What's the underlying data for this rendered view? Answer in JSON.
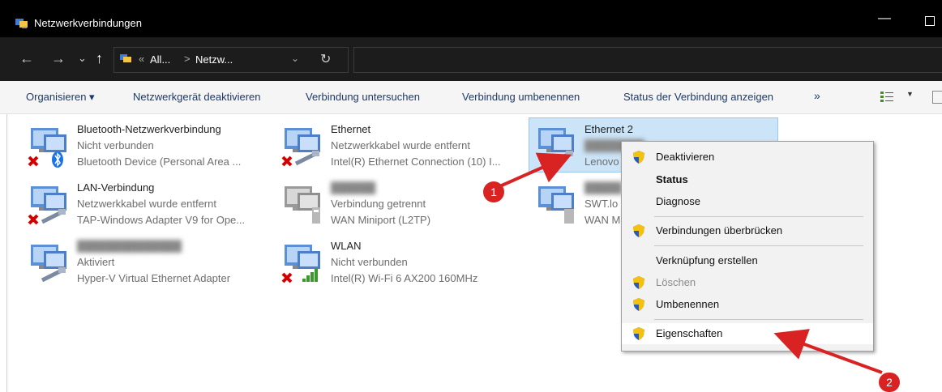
{
  "window": {
    "title": "Netzwerkverbindungen",
    "minimize_glyph": "—"
  },
  "address_bar": {
    "nav": {
      "back": "←",
      "forward": "→",
      "recent": "⌄",
      "up": "↑"
    },
    "path_prefix": "«",
    "segments": [
      "All...",
      "Netzw..."
    ],
    "separator": ">",
    "dropdown": "⌄",
    "refresh": "↻"
  },
  "command_bar": {
    "items": [
      "Organisieren ▾",
      "Netzwerkgerät deaktivieren",
      "Verbindung untersuchen",
      "Verbindung umbenennen",
      "Status der Verbindung anzeigen"
    ],
    "more": "»",
    "view_dropdown": "▼"
  },
  "connections": [
    {
      "name": "Bluetooth-Netzwerkverbindung",
      "status": "Nicht verbunden",
      "device": "Bluetooth Device (Personal Area ...",
      "icon": "bluetooth-network-icon",
      "error": true
    },
    {
      "name": "Ethernet",
      "status": "Netzwerkkabel wurde entfernt",
      "device": "Intel(R) Ethernet Connection (10) I...",
      "icon": "ethernet-network-icon",
      "error": true
    },
    {
      "name": "Ethernet 2",
      "status": "",
      "device": "Lenovo",
      "icon": "ethernet-network-icon",
      "error": false,
      "selected": true
    },
    {
      "name": "LAN-Verbindung",
      "status": "Netzwerkkabel wurde entfernt",
      "device": "TAP-Windows Adapter V9 for Ope...",
      "icon": "ethernet-network-icon",
      "error": true
    },
    {
      "name": "",
      "status": "Verbindung getrennt",
      "device": "WAN Miniport (L2TP)",
      "icon": "wan-network-icon",
      "error": false
    },
    {
      "name": "",
      "status": "SWT.lo",
      "device": "WAN M",
      "icon": "ethernet-network-icon",
      "error": false
    },
    {
      "name": "",
      "status": "Aktiviert",
      "device": "Hyper-V Virtual Ethernet Adapter",
      "icon": "ethernet-network-icon",
      "error": false
    },
    {
      "name": "WLAN",
      "status": "Nicht verbunden",
      "device": "Intel(R) Wi-Fi 6 AX200 160MHz",
      "icon": "wifi-network-icon",
      "error": true
    }
  ],
  "context_menu": {
    "items": [
      {
        "label": "Deaktivieren",
        "shield": true,
        "bold": false,
        "disabled": false
      },
      {
        "label": "Status",
        "shield": false,
        "bold": true,
        "disabled": false
      },
      {
        "label": "Diagnose",
        "shield": false,
        "bold": false,
        "disabled": false
      },
      {
        "label": "Verbindungen überbrücken",
        "shield": true,
        "bold": false,
        "disabled": false
      },
      {
        "label": "Verknüpfung erstellen",
        "shield": false,
        "bold": false,
        "disabled": false
      },
      {
        "label": "Löschen",
        "shield": true,
        "bold": false,
        "disabled": true
      },
      {
        "label": "Umbenennen",
        "shield": true,
        "bold": false,
        "disabled": false
      },
      {
        "label": "Eigenschaften",
        "shield": true,
        "bold": false,
        "disabled": false,
        "highlighted": true
      }
    ]
  },
  "annotations": {
    "badge_1": "1",
    "badge_2": "2",
    "color": "#d92323"
  },
  "colors": {
    "titlebar": "#000000",
    "addressbar": "#1c1c1c",
    "commandbar": "#f5f5f5",
    "selection": "#cce4f7",
    "error_x": "#d40000",
    "bluetooth": "#1a74e8",
    "uac_shield_blue": "#2a5db0",
    "uac_shield_yellow": "#f4c20d"
  }
}
